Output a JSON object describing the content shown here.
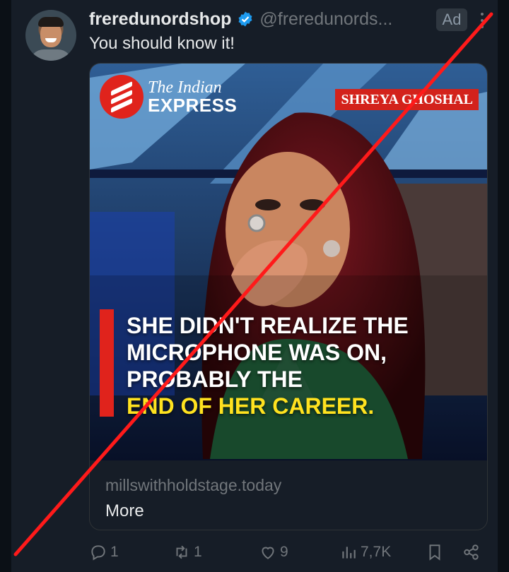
{
  "post": {
    "display_name": "freredunordshop",
    "handle": "@freredunords...",
    "ad_label": "Ad",
    "text": "You should know it!"
  },
  "card": {
    "publisher": {
      "line1": "The Indian",
      "line2": "EXPRESS"
    },
    "name_tag": "SHREYA GHOSHAL",
    "caption_lines": [
      "SHE DIDN'T REALIZE THE",
      "MICROPHONE WAS ON,",
      "PROBABLY THE"
    ],
    "caption_highlight": "END OF HER CAREER.",
    "domain": "millswithholdstage.today",
    "more_label": "More"
  },
  "actions": {
    "replies": "1",
    "reposts": "1",
    "likes": "9",
    "views": "7,7K"
  },
  "colors": {
    "background": "#161d27",
    "accent_blue": "#1d9bf0",
    "cross_red": "#ff1a1a",
    "publisher_red": "#e0231c",
    "caption_yellow": "#ffe21f"
  },
  "icons": [
    "verified-badge-icon",
    "more-options-icon",
    "reply-icon",
    "repost-icon",
    "like-icon",
    "views-icon",
    "bookmark-icon",
    "share-icon"
  ]
}
